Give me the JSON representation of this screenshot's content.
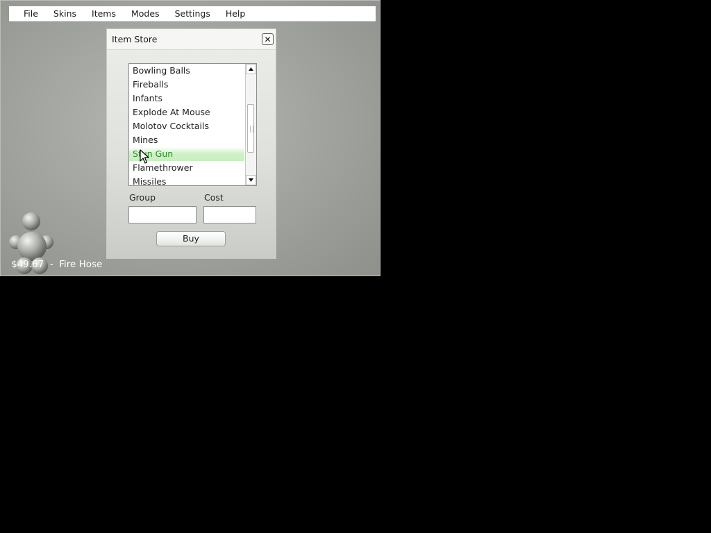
{
  "menubar": {
    "items": [
      "File",
      "Skins",
      "Items",
      "Modes",
      "Settings",
      "Help"
    ]
  },
  "dialog": {
    "title": "Item Store",
    "close_symbol": "✕",
    "close_icon": "close-icon",
    "list": {
      "items": [
        "Bowling Balls",
        "Fireballs",
        "Infants",
        "Explode At Mouse",
        "Molotov Cocktails",
        "Mines",
        "Stun Gun",
        "Flamethrower",
        "Missiles"
      ],
      "selected_item": "Stun Gun",
      "scroll_up_icon": "triangle-up-icon",
      "scroll_down_icon": "triangle-down-icon"
    },
    "group": {
      "label": "Group",
      "value": ""
    },
    "cost": {
      "label": "Cost",
      "value": ""
    },
    "buy_label": "Buy"
  },
  "status": {
    "text": "$49.67  -  Fire Hose"
  },
  "icons": {
    "mascot": "ball-figure-icon",
    "cursor": "mouse-pointer-icon"
  },
  "colors": {
    "selection_text": "#2f8a2a",
    "selection_bg": "#c8efc0",
    "window_bg": "#a3a6a1"
  }
}
